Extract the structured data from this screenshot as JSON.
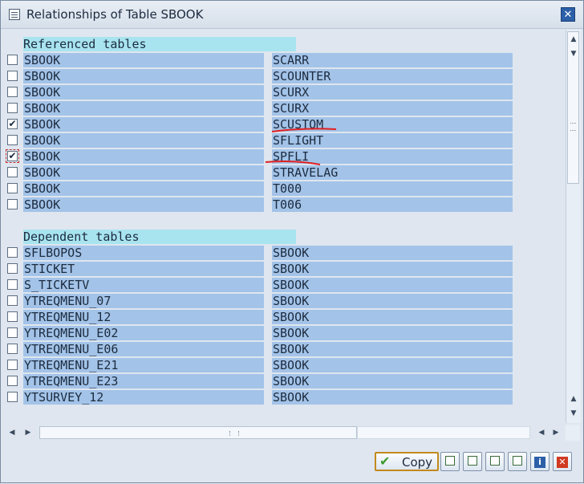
{
  "window": {
    "title": "Relationships of Table SBOOK",
    "close_icon": "close-icon"
  },
  "referenced": {
    "heading": "Referenced tables",
    "rows": [
      {
        "left": "SBOOK",
        "right": "SCARR",
        "checked": false
      },
      {
        "left": "SBOOK",
        "right": "SCOUNTER",
        "checked": false
      },
      {
        "left": "SBOOK",
        "right": "SCURX",
        "checked": false
      },
      {
        "left": "SBOOK",
        "right": "SCURX",
        "checked": false
      },
      {
        "left": "SBOOK",
        "right": "SCUSTOM",
        "checked": true
      },
      {
        "left": "SBOOK",
        "right": "SFLIGHT",
        "checked": false
      },
      {
        "left": "SBOOK",
        "right": "SPFLI",
        "checked": true
      },
      {
        "left": "SBOOK",
        "right": "STRAVELAG",
        "checked": false
      },
      {
        "left": "SBOOK",
        "right": "T000",
        "checked": false
      },
      {
        "left": "SBOOK",
        "right": "T006",
        "checked": false
      }
    ]
  },
  "dependent": {
    "heading": "Dependent tables",
    "rows": [
      {
        "left": "SFLBOPOS",
        "right": "SBOOK",
        "checked": false
      },
      {
        "left": "STICKET",
        "right": "SBOOK",
        "checked": false
      },
      {
        "left": "S_TICKETV",
        "right": "SBOOK",
        "checked": false
      },
      {
        "left": "YTREQMENU_07",
        "right": "SBOOK",
        "checked": false
      },
      {
        "left": "YTREQMENU_12",
        "right": "SBOOK",
        "checked": false
      },
      {
        "left": "YTREQMENU_E02",
        "right": "SBOOK",
        "checked": false
      },
      {
        "left": "YTREQMENU_E06",
        "right": "SBOOK",
        "checked": false
      },
      {
        "left": "YTREQMENU_E21",
        "right": "SBOOK",
        "checked": false
      },
      {
        "left": "YTREQMENU_E23",
        "right": "SBOOK",
        "checked": false
      },
      {
        "left": "YTSURVEY_12",
        "right": "SBOOK",
        "checked": false
      }
    ]
  },
  "footer": {
    "copy_label": "Copy",
    "icons": [
      "copy-icon",
      "select-all-icon",
      "deselect-all-icon",
      "select-block-icon",
      "deselect-block-icon",
      "info-icon",
      "cancel-icon"
    ]
  },
  "colors": {
    "accent": "#2c5fa8",
    "cell": "#a3c3e8",
    "heading": "#a8e4ef",
    "annotation": "#e02020"
  }
}
